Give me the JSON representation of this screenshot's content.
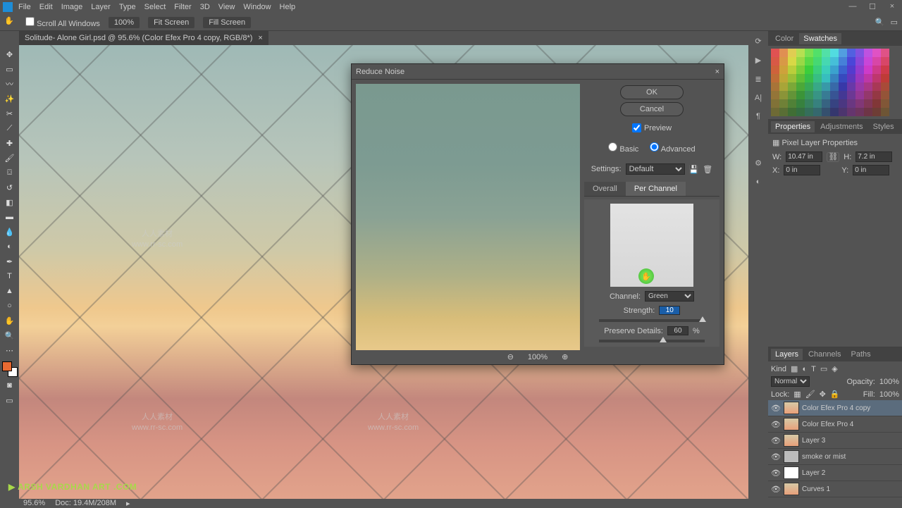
{
  "menubar": {
    "items": [
      "File",
      "Edit",
      "Image",
      "Layer",
      "Type",
      "Select",
      "Filter",
      "3D",
      "View",
      "Window",
      "Help"
    ]
  },
  "optionsbar": {
    "scroll_all": "Scroll All Windows",
    "zoom": "100%",
    "fit": "Fit Screen",
    "fill": "Fill Screen"
  },
  "tab": {
    "title": "Solitude- Alone Girl.psd @ 95.6% (Color Efex Pro 4 copy, RGB/8*)",
    "close": "×"
  },
  "panels": {
    "color_tab": "Color",
    "swatches_tab": "Swatches",
    "properties_tab": "Properties",
    "adjustments_tab": "Adjustments",
    "styles_tab": "Styles",
    "pixel_layer": "Pixel Layer Properties",
    "w_label": "W:",
    "w_val": "10.47 in",
    "link": "⛓",
    "h_label": "H:",
    "h_val": "7.2 in",
    "x_label": "X:",
    "x_val": "0 in",
    "y_label": "Y:",
    "y_val": "0 in",
    "layers_tab": "Layers",
    "channels_tab": "Channels",
    "paths_tab": "Paths",
    "kind_label": "Kind",
    "blend_mode": "Normal",
    "opacity_label": "Opacity:",
    "opacity_val": "100%",
    "lock_label": "Lock:",
    "fill_label": "Fill:",
    "fill_val": "100%",
    "layers": [
      {
        "name": "Color Efex Pro 4 copy",
        "sel": true
      },
      {
        "name": "Color Efex Pro 4",
        "sel": false
      },
      {
        "name": "Layer 3",
        "sel": false
      },
      {
        "name": "smoke or mist",
        "sel": false
      },
      {
        "name": "Layer 2",
        "sel": false
      },
      {
        "name": "Curves 1",
        "sel": false
      }
    ]
  },
  "dialog": {
    "title": "Reduce Noise",
    "ok": "OK",
    "cancel": "Cancel",
    "preview": "Preview",
    "basic": "Basic",
    "advanced": "Advanced",
    "settings_label": "Settings:",
    "settings_value": "Default",
    "tab_overall": "Overall",
    "tab_perchannel": "Per Channel",
    "channel_label": "Channel:",
    "channel_value": "Green",
    "strength_label": "Strength:",
    "strength_value": "10",
    "preserve_label": "Preserve Details:",
    "preserve_value": "60",
    "percent": "%",
    "zoom_out": "⊖",
    "zoom_val": "100%",
    "zoom_in": "⊕",
    "close_x": "×",
    "cursor": "✋"
  },
  "status": {
    "zoom": "95.6%",
    "doc": "Doc: 19.4M/208M",
    "arrow": "▸"
  },
  "logo": "▶ ARSH VARDHAN ART .COM",
  "watermark": {
    "cn": "人人素材",
    "url": "www.rr-sc.com"
  },
  "colors": {
    "fg": "#e86a32",
    "bg": "#ffffff"
  }
}
